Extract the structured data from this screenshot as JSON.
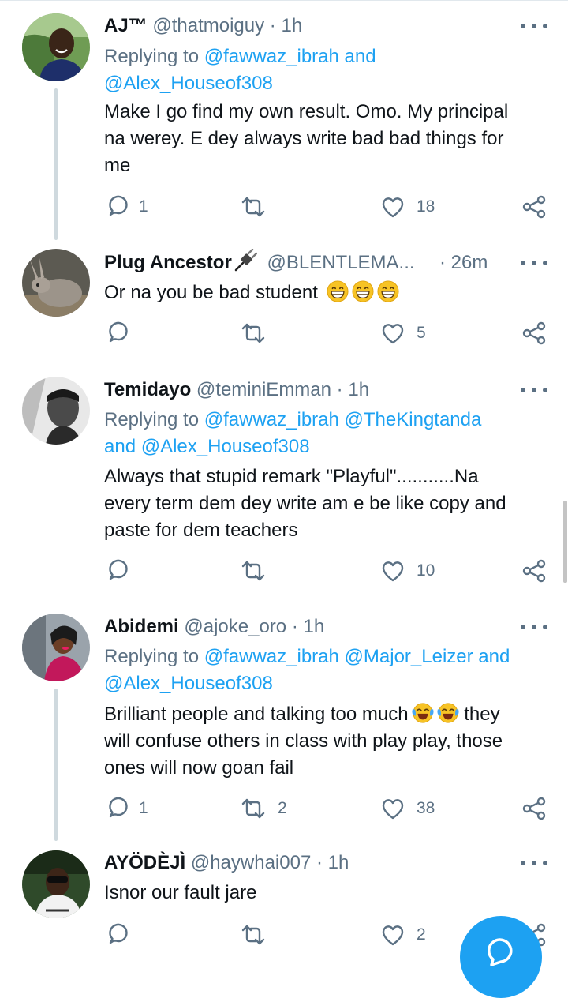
{
  "colors": {
    "accent": "#1da1f2",
    "muted": "#5b7083",
    "text": "#0f1419",
    "divider": "#e1e8ed"
  },
  "tweets": [
    {
      "name": "AJ™",
      "handle": "@thatmoiguy",
      "dot": "·",
      "time": "1h",
      "replying_prefix": "Replying to",
      "replying_line1_user": "@fawwaz_ibrah",
      "replying_line1_suffix": "and",
      "replying_line2": "@Alex_Houseof308",
      "lines": [
        "Make I go find my own result. Omo. My principal",
        "na werey. E dey always write bad bad things for",
        "me"
      ],
      "reply_count": "1",
      "retweet_count": "",
      "like_count": "18"
    },
    {
      "name": "Plug Ancestor",
      "name_icon": "electric-plug-icon",
      "handle": "@BLENTLEMA...",
      "dot": "·",
      "time": "26m",
      "text": "Or na you be bad student",
      "emoji": "grinning-face-icon",
      "reply_count": "",
      "retweet_count": "",
      "like_count": "5"
    },
    {
      "name": "Temidayo",
      "handle": "@teminiEmman",
      "dot": "·",
      "time": "1h",
      "replying_prefix": "Replying to",
      "replying_line1_user": "@fawwaz_ibrah",
      "replying_line1_user2": "@TheKingtanda",
      "replying_line2_prefix": "and",
      "replying_line2_user": "@Alex_Houseof308",
      "lines": [
        "Always that stupid remark \"Playful\"...........Na",
        "every term dem dey write am e be like copy and",
        "paste for dem teachers"
      ],
      "reply_count": "",
      "retweet_count": "",
      "like_count": "10"
    },
    {
      "name": "Abidemi",
      "handle": "@ajoke_oro",
      "dot": "·",
      "time": "1h",
      "replying_prefix": "Replying to",
      "replying_line1_user": "@fawwaz_ibrah",
      "replying_line1_user2": "@Major_Leizer",
      "replying_line1_suffix": "and",
      "replying_line2": "@Alex_Houseof308",
      "line1_before": "Brilliant people and talking too much",
      "line1_after": "they",
      "emoji": "face-with-tears-of-joy-icon",
      "lines": [
        "will confuse others in class with play play, those",
        "ones will now goan fail"
      ],
      "reply_count": "1",
      "retweet_count": "2",
      "like_count": "38"
    },
    {
      "name": "AYÖDÈJÌ",
      "handle": "@haywhai007",
      "dot": "·",
      "time": "1h",
      "text": "Isnor our fault jare",
      "reply_count": "",
      "retweet_count": "",
      "like_count": "2"
    }
  ],
  "compose_button": {
    "icon": "compose-reply-icon"
  }
}
